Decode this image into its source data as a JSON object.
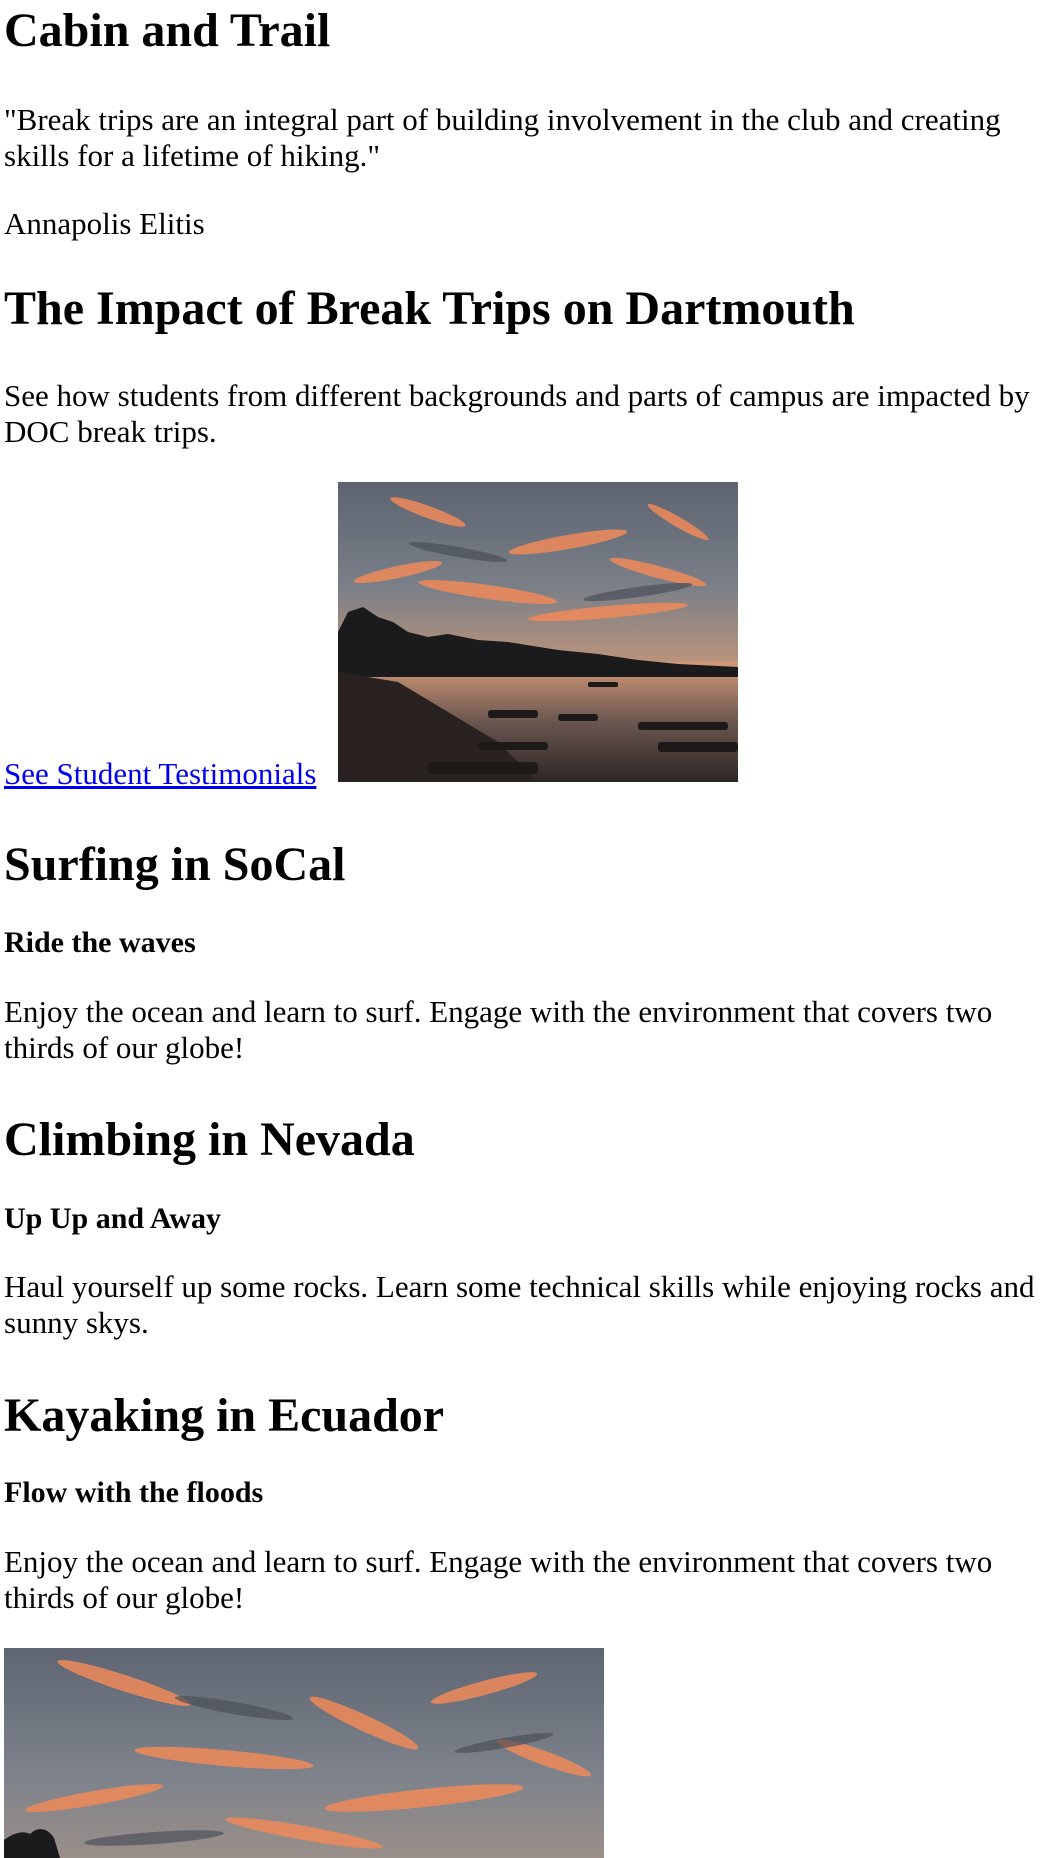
{
  "header": {
    "title": "Cabin and Trail"
  },
  "quote": {
    "text": "\"Break trips are an integral part of building involvement in the club and creating skills for a lifetime of hiking.\"",
    "author": "Annapolis Elitis"
  },
  "impact": {
    "title": "The Impact of Break Trips on Dartmouth",
    "description": "See how students from different backgrounds and parts of campus are impacted by DOC break trips.",
    "link_label": "See Student Testimonials",
    "image_icon": "sunset-beach-photo"
  },
  "trips": [
    {
      "title": "Surfing in SoCal",
      "subtitle": "Ride the waves",
      "description": "Enjoy the ocean and learn to surf. Engage with the environment that covers two thirds of our globe!"
    },
    {
      "title": "Climbing in Nevada",
      "subtitle": "Up Up and Away",
      "description": "Haul yourself up some rocks. Learn some technical skills while enjoying rocks and sunny skys."
    },
    {
      "title": "Kayaking in Ecuador",
      "subtitle": "Flow with the floods",
      "description": "Enjoy the ocean and learn to surf. Engage with the environment that covers two thirds of our globe!"
    }
  ],
  "footer_image": {
    "image_icon": "sunset-sky-photo"
  },
  "colors": {
    "link": "#0000ee",
    "text": "#000000",
    "background": "#ffffff"
  }
}
